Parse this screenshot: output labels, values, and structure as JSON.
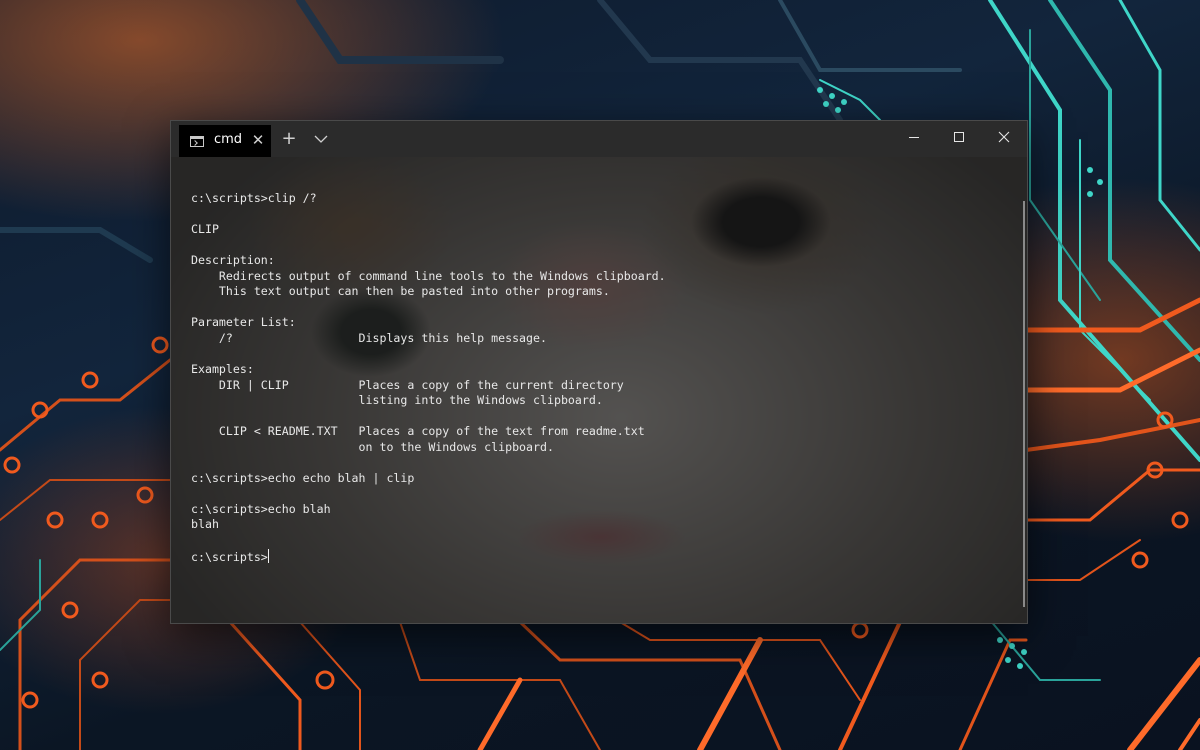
{
  "window": {
    "tab_title": "cmd",
    "tab_icon": "terminal-icon",
    "close_tab_glyph": "✕",
    "new_tab_glyph": "+",
    "dropdown_glyph": "⌄",
    "minimize_glyph": "—",
    "maximize_glyph": "☐",
    "close_glyph": "✕"
  },
  "terminal": {
    "lines": [
      "c:\\scripts>clip /?",
      "",
      "CLIP",
      "",
      "Description:",
      "    Redirects output of command line tools to the Windows clipboard.",
      "    This text output can then be pasted into other programs.",
      "",
      "Parameter List:",
      "    /?                  Displays this help message.",
      "",
      "Examples:",
      "    DIR | CLIP          Places a copy of the current directory",
      "                        listing into the Windows clipboard.",
      "",
      "    CLIP < README.TXT   Places a copy of the text from readme.txt",
      "                        on to the Windows clipboard.",
      "",
      "c:\\scripts>echo echo blah | clip",
      "",
      "c:\\scripts>echo blah",
      "blah",
      "",
      "c:\\scripts>"
    ]
  },
  "colors": {
    "tab_background": "#000000",
    "titlebar_background": "#2b2b2b",
    "terminal_text": "#e8e8e8",
    "accent_orange": "#f05a1e",
    "accent_teal": "#3fd6c8"
  }
}
